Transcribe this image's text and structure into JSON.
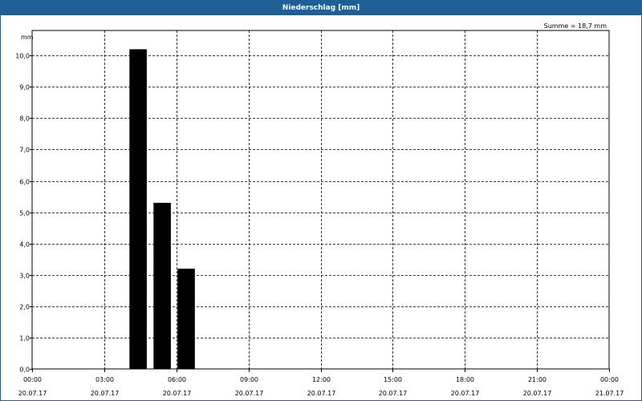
{
  "window": {
    "title": "Niederschlag [mm]"
  },
  "chart_data": {
    "type": "bar",
    "unit": "mm",
    "sum_label": "Summe = 18,7 mm",
    "x": [
      "04:00",
      "05:00",
      "06:00"
    ],
    "values": [
      10.2,
      5.3,
      3.2
    ],
    "xlim": [
      "20.07.17 00:00",
      "21.07.17 00:00"
    ],
    "ylim": [
      0,
      10.8
    ],
    "yticks": [
      "0,0",
      "1,0",
      "2,0",
      "3,0",
      "4,0",
      "5,0",
      "6,0",
      "7,0",
      "8,0",
      "9,0",
      "10,0"
    ],
    "xticks": [
      {
        "time": "00:00",
        "date": "20.07.17"
      },
      {
        "time": "03:00",
        "date": "20.07.17"
      },
      {
        "time": "06:00",
        "date": "20.07.17"
      },
      {
        "time": "09:00",
        "date": "20.07.17"
      },
      {
        "time": "12:00",
        "date": "20.07.17"
      },
      {
        "time": "15:00",
        "date": "20.07.17"
      },
      {
        "time": "18:00",
        "date": "20.07.17"
      },
      {
        "time": "21:00",
        "date": "20.07.17"
      },
      {
        "time": "00:00",
        "date": "21.07.17"
      }
    ],
    "grid": true,
    "bar_color": "#000000"
  }
}
